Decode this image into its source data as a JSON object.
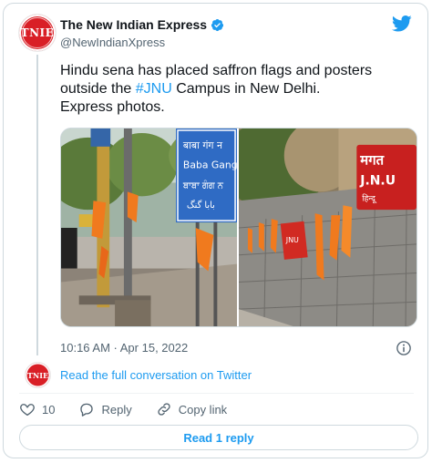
{
  "author": {
    "avatar_text": "TNIE",
    "name": "The New Indian Express",
    "handle": "@NewIndianXpress"
  },
  "tweet": {
    "line1": "Hindu sena has placed saffron flags and posters",
    "line2_before": "outside the ",
    "hashtag": "#JNU",
    "line2_after": " Campus in New Delhi.",
    "line3": "Express photos."
  },
  "photos": {
    "left_sign_line1": "बाबा गंग न",
    "left_sign_line2": "Baba Gang",
    "left_sign_line3": "ਬਾਬਾ ਗੰਗ ਨ",
    "left_sign_line4": "بابا گنگ",
    "right_sign_line1": "मगत",
    "right_sign_line2": "J.N.U",
    "right_sign_line3": "हिन्दू",
    "small_poster": "JNU"
  },
  "timestamp": "10:16 AM · Apr 15, 2022",
  "conversation_link": "Read the full conversation on Twitter",
  "actions": {
    "like_count": "10",
    "reply_label": "Reply",
    "copy_link_label": "Copy link"
  },
  "read_replies_button": "Read 1 reply",
  "colors": {
    "accent": "#1d9bf0",
    "brand_red": "#d91f26",
    "secondary_text": "#536471",
    "border": "#cfd9de"
  }
}
